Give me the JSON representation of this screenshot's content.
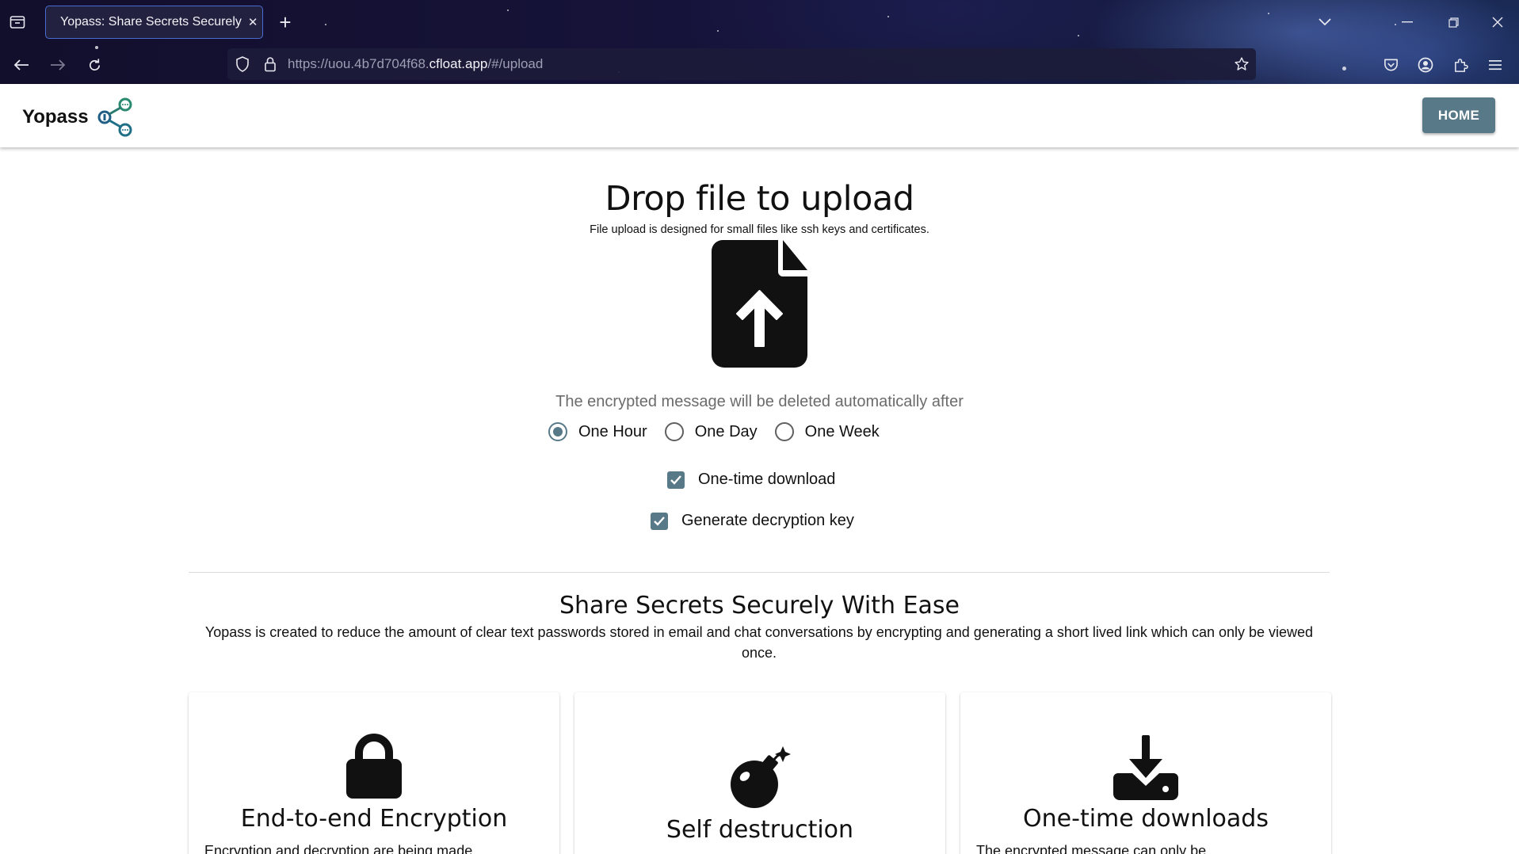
{
  "browser": {
    "tab_title": "Yopass: Share Secrets Securely",
    "url_prefix": "https://uou.4b7d704f68.",
    "url_domain": "cfloat.app",
    "url_suffix": "/#/upload"
  },
  "header": {
    "brand": "Yopass",
    "home_button": "HOME"
  },
  "upload": {
    "title": "Drop file to upload",
    "subtitle": "File upload is designed for small files like ssh keys and certificates.",
    "expire_label": "The encrypted message will be deleted automatically after",
    "expiration_options": [
      "One Hour",
      "One Day",
      "One Week"
    ],
    "selected_expiration": "One Hour",
    "one_time_download_label": "One-time download",
    "one_time_download_checked": true,
    "generate_key_label": "Generate decryption key",
    "generate_key_checked": true
  },
  "features": {
    "title": "Share Secrets Securely With Ease",
    "description": "Yopass is created to reduce the amount of clear text passwords stored in email and chat conversations by encrypting and generating a short lived link which can only be viewed once.",
    "cards": [
      {
        "title": "End-to-end Encryption",
        "text": "Encryption and decryption are being made",
        "icon": "lock-icon"
      },
      {
        "title": "Self destruction",
        "text": "",
        "icon": "bomb-icon"
      },
      {
        "title": "One-time downloads",
        "text": "The encrypted message can only be",
        "icon": "download-icon"
      }
    ]
  },
  "colors": {
    "accent": "#587987",
    "brand_icon": "#2a7a6f"
  }
}
